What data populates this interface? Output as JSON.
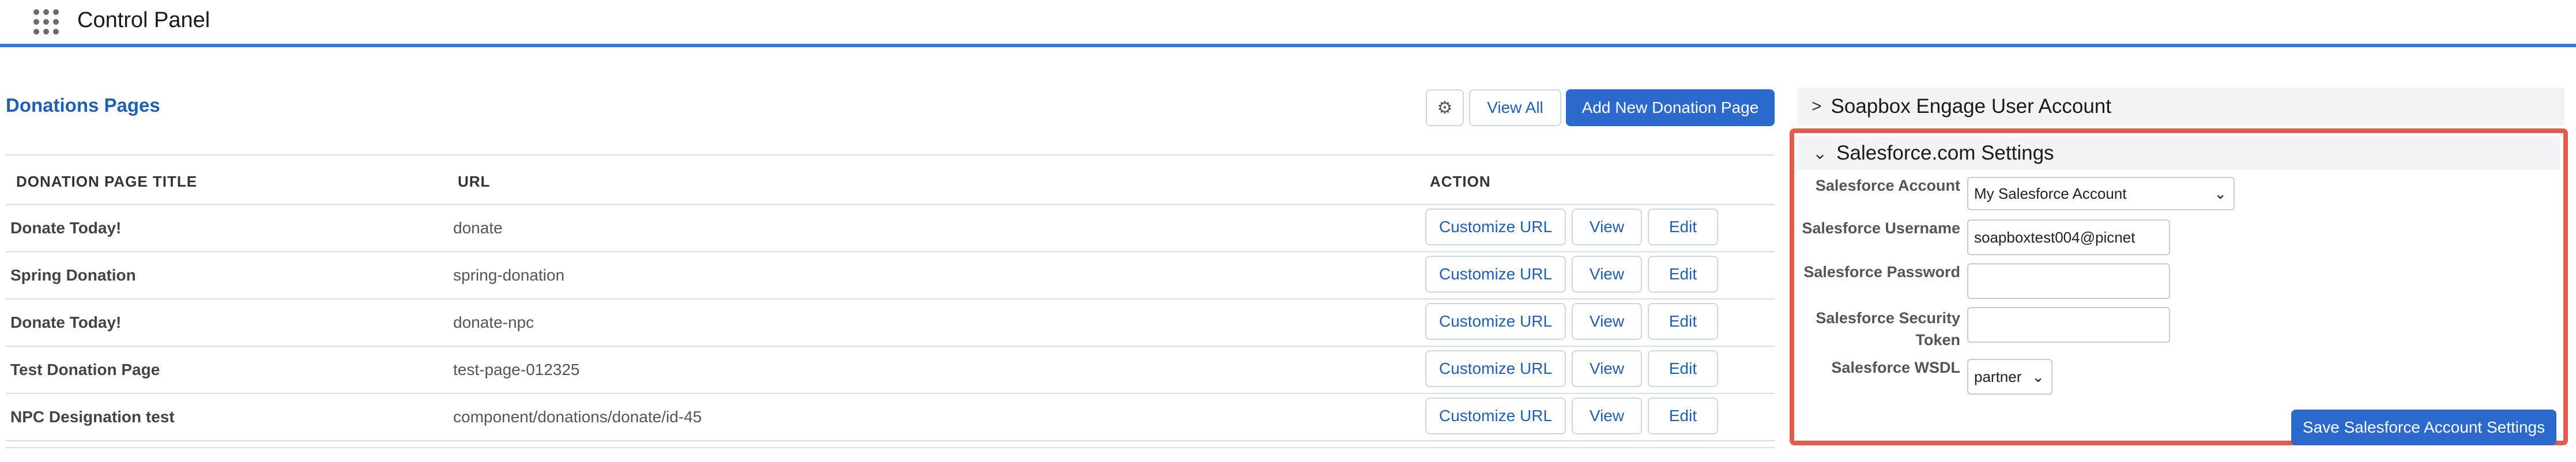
{
  "header": {
    "app_title": "Control Panel",
    "launcher_icon": "app-launcher-icon"
  },
  "donations": {
    "title": "Donations Pages",
    "toolbar": {
      "settings_icon": "gear-icon",
      "view_all_label": "View All",
      "add_new_label": "Add New Donation Page"
    },
    "columns": {
      "title": "DONATION PAGE TITLE",
      "url": "URL",
      "action": "ACTION"
    },
    "rows": [
      {
        "title": "Donate Today!",
        "url": "donate"
      },
      {
        "title": "Spring Donation",
        "url": "spring-donation"
      },
      {
        "title": "Donate Today!",
        "url": "donate-npc"
      },
      {
        "title": "Test Donation Page",
        "url": "test-page-012325"
      },
      {
        "title": "NPC Designation test",
        "url": "component/donations/donate/id-45"
      }
    ],
    "row_actions": {
      "customize": "Customize URL",
      "view": "View",
      "edit": "Edit"
    }
  },
  "side": {
    "soapbox_header": "Soapbox Engage User Account",
    "salesforce": {
      "header": "Salesforce.com Settings",
      "account_label": "Salesforce Account",
      "account_value": "My Salesforce Account",
      "username_label": "Salesforce Username",
      "username_value": "soapboxtest004@picnet",
      "password_label": "Salesforce Password",
      "password_value": "",
      "token_label_1": "Salesforce Security",
      "token_label_2": "Token",
      "token_value": "",
      "wsdl_label": "Salesforce WSDL",
      "wsdl_value": "partner",
      "save_label": "Save Salesforce Account Settings"
    }
  },
  "colors": {
    "accent": "#2c69cc",
    "highlight": "#e35b4d",
    "link": "#1f5fb4"
  }
}
